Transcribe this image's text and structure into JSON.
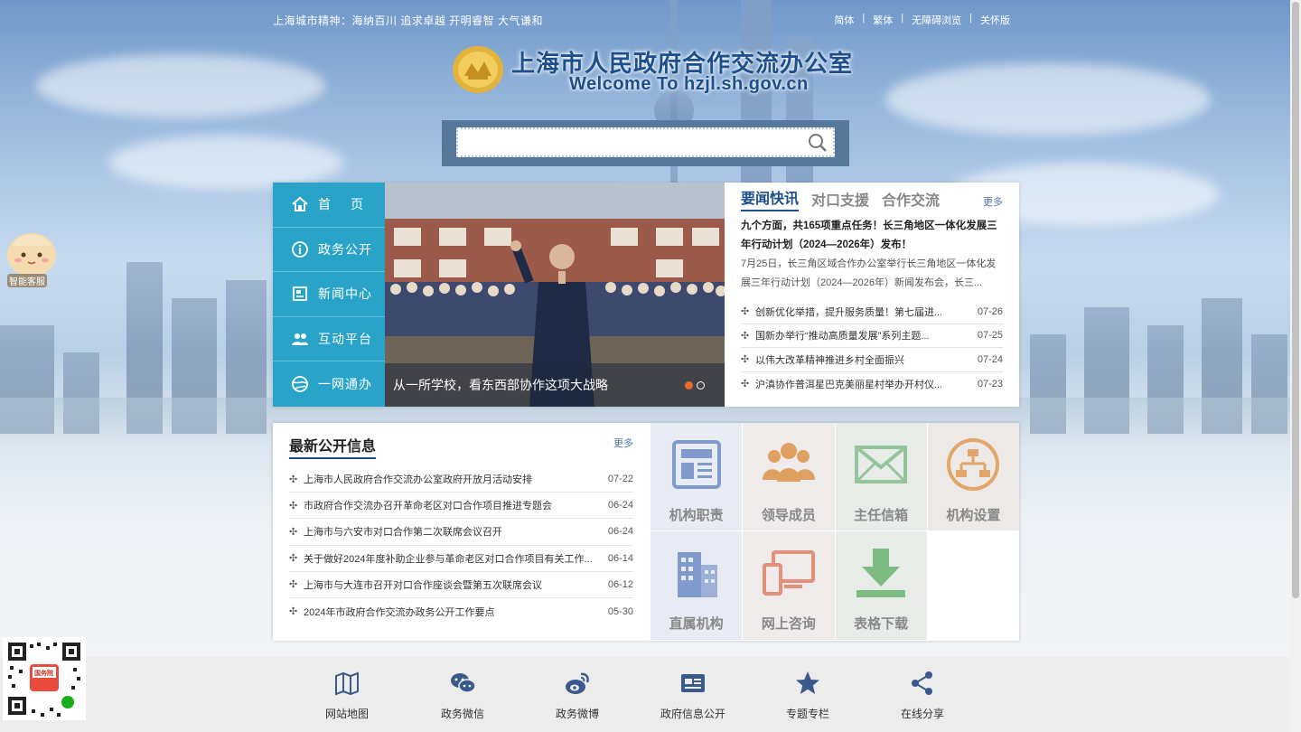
{
  "top": {
    "spirit": "上海城市精神：海纳百川  追求卓越  开明睿智  大气谦和",
    "links": [
      "简体",
      "繁体",
      "无障碍浏览",
      "关怀版"
    ]
  },
  "header": {
    "title": "上海市人民政府合作交流办公室",
    "subtitle": "Welcome To hzjl.sh.gov.cn"
  },
  "search": {
    "placeholder": ""
  },
  "nav": {
    "items": [
      {
        "label": "首页",
        "icon": "home-icon"
      },
      {
        "label": "政务公开",
        "icon": "info-icon"
      },
      {
        "label": "新闻中心",
        "icon": "news-icon"
      },
      {
        "label": "互动平台",
        "icon": "users-icon"
      },
      {
        "label": "一网通办",
        "icon": "globe-icon"
      }
    ]
  },
  "slider": {
    "caption": "从一所学校，看东西部协作这项大战略",
    "active_slide": 1,
    "slide_count": 2
  },
  "news": {
    "tabs": [
      "要闻快讯",
      "对口支援",
      "合作交流"
    ],
    "more": "更多",
    "headline": "九个方面，共165项重点任务！长三角地区一体化发展三年行动计划（2024—2026年）发布！",
    "summary": "7月25日，长三角区域合作办公室举行长三角地区一体化发展三年行动计划（2024—2026年）新闻发布会，长三...",
    "items": [
      {
        "title": "创新优化举措，提升服务质量！第七届进...",
        "date": "07-26"
      },
      {
        "title": "国新办举行“推动高质量发展”系列主题...",
        "date": "07-25"
      },
      {
        "title": "以伟大改革精神推进乡村全面振兴",
        "date": "07-24"
      },
      {
        "title": "沪滇协作普洱星巴克美丽星村举办开村仪...",
        "date": "07-23"
      }
    ]
  },
  "open_info": {
    "title": "最新公开信息",
    "more": "更多",
    "items": [
      {
        "title": "上海市人民政府合作交流办公室政府开放月活动安排",
        "date": "07-22"
      },
      {
        "title": "市政府合作交流办召开革命老区对口合作项目推进专题会",
        "date": "06-24"
      },
      {
        "title": "上海市与六安市对口合作第二次联席会议召开",
        "date": "06-24"
      },
      {
        "title": "关于做好2024年度补助企业参与革命老区对口合作项目有关工作...",
        "date": "06-14"
      },
      {
        "title": "上海市与大连市召开对口合作座谈会暨第五次联席会议",
        "date": "06-12"
      },
      {
        "title": "2024年市政府合作交流办政务公开工作要点",
        "date": "05-30"
      }
    ]
  },
  "tiles": [
    {
      "label": "机构职责",
      "icon": "document-icon",
      "color": "#7f9acb"
    },
    {
      "label": "领导成员",
      "icon": "leaders-icon",
      "color": "#e0a060"
    },
    {
      "label": "主任信箱",
      "icon": "mail-icon",
      "color": "#93c49a"
    },
    {
      "label": "机构设置",
      "icon": "org-chart-icon",
      "color": "#e2a56a"
    },
    {
      "label": "直属机构",
      "icon": "building-icon",
      "color": "#7f9acb"
    },
    {
      "label": "网上咨询",
      "icon": "devices-icon",
      "color": "#e38f7a"
    },
    {
      "label": "表格下载",
      "icon": "download-icon",
      "color": "#7dbb83"
    }
  ],
  "footer": {
    "items": [
      {
        "label": "网站地图",
        "icon": "map-icon"
      },
      {
        "label": "政务微信",
        "icon": "wechat-icon"
      },
      {
        "label": "政务微博",
        "icon": "weibo-icon"
      },
      {
        "label": "政府信息公开",
        "icon": "info-card-icon"
      },
      {
        "label": "专题专栏",
        "icon": "star-icon"
      },
      {
        "label": "在线分享",
        "icon": "share-icon"
      }
    ]
  },
  "widgets": {
    "kefu": "智能客服",
    "qr_label": "国务院"
  },
  "colors": {
    "nav": "#2aa3c9",
    "brand": "#1c4f8a",
    "search_frame": "#56789a",
    "slider_dot_active": "#ec6a2c"
  }
}
